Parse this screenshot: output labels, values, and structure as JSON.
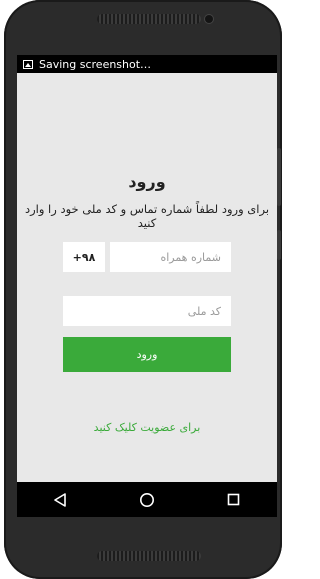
{
  "status_bar": {
    "notification_text": "Saving screenshot…",
    "notification_icon": "image-icon"
  },
  "login": {
    "title": "ورود",
    "subtitle": "برای ورود لطفاً شماره تماس و کد ملی خود را وارد کنید",
    "country_code": "+۹۸",
    "phone_placeholder": "شماره همراه",
    "phone_value": "",
    "national_id_placeholder": "کد ملی",
    "national_id_value": "",
    "login_button_label": "ورود",
    "signup_link": "برای عضویت کلیک کنید"
  },
  "nav_bar": {
    "icons": [
      "back-icon",
      "home-icon",
      "recents-icon"
    ]
  },
  "colors": {
    "accent": "#3aaa3a",
    "screen_background": "#e8e8e8",
    "device_frame": "#2b2b2b"
  }
}
